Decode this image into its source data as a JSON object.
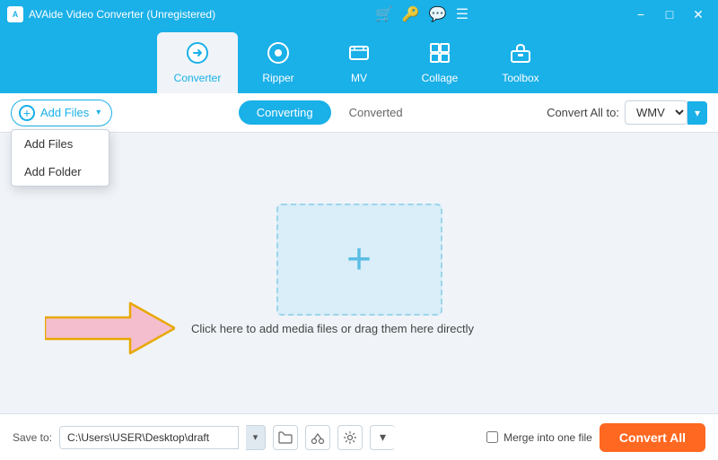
{
  "titleBar": {
    "title": "AVAide Video Converter (Unregistered)",
    "icon": "A",
    "buttons": [
      "cart-icon",
      "key-icon",
      "chat-icon",
      "menu-icon",
      "minimize-icon",
      "maximize-icon",
      "close-icon"
    ]
  },
  "navBar": {
    "items": [
      {
        "id": "converter",
        "label": "Converter",
        "icon": "⟳",
        "active": true
      },
      {
        "id": "ripper",
        "label": "Ripper",
        "icon": "◎"
      },
      {
        "id": "mv",
        "label": "MV",
        "icon": "🖼"
      },
      {
        "id": "collage",
        "label": "Collage",
        "icon": "⊞"
      },
      {
        "id": "toolbox",
        "label": "Toolbox",
        "icon": "🧰"
      }
    ]
  },
  "toolbar": {
    "addFilesLabel": "Add Files",
    "dropdownArrow": "▾",
    "dropdownItems": [
      "Add Files",
      "Add Folder"
    ],
    "tabs": [
      {
        "id": "converting",
        "label": "Converting",
        "active": true
      },
      {
        "id": "converted",
        "label": "Converted"
      }
    ],
    "convertAllToLabel": "Convert All to:",
    "selectedFormat": "WMV"
  },
  "dropZone": {
    "plusIcon": "+",
    "hint": "Click here to add media files or drag them here directly"
  },
  "bottomBar": {
    "saveToLabel": "Save to:",
    "savePath": "C:\\Users\\USER\\Desktop\\draft",
    "mergeLabel": "Merge into one file",
    "convertAllLabel": "Convert All"
  }
}
